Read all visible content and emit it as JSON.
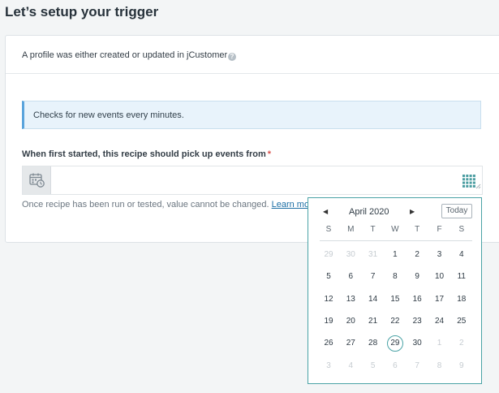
{
  "page": {
    "title": "Let’s setup your trigger"
  },
  "trigger": {
    "description": "A profile was either created or updated in jCustomer",
    "help_icon": "?"
  },
  "info": {
    "text": "Checks for new events every minutes."
  },
  "field": {
    "label": "When first started, this recipe should pick up events from",
    "required_mark": "*",
    "value": "",
    "hint": "Once recipe has been run or tested, value cannot be changed.",
    "learn_more": "Learn more"
  },
  "calendar": {
    "month_label": "April 2020",
    "prev_icon": "◀",
    "next_icon": "▶",
    "today_label": "Today",
    "weekdays": [
      "S",
      "M",
      "T",
      "W",
      "T",
      "F",
      "S"
    ],
    "weeks": [
      [
        {
          "d": "29",
          "m": true
        },
        {
          "d": "30",
          "m": true
        },
        {
          "d": "31",
          "m": true
        },
        {
          "d": "1"
        },
        {
          "d": "2"
        },
        {
          "d": "3"
        },
        {
          "d": "4"
        }
      ],
      [
        {
          "d": "5"
        },
        {
          "d": "6"
        },
        {
          "d": "7"
        },
        {
          "d": "8"
        },
        {
          "d": "9"
        },
        {
          "d": "10"
        },
        {
          "d": "11"
        }
      ],
      [
        {
          "d": "12"
        },
        {
          "d": "13"
        },
        {
          "d": "14"
        },
        {
          "d": "15"
        },
        {
          "d": "16"
        },
        {
          "d": "17"
        },
        {
          "d": "18"
        }
      ],
      [
        {
          "d": "19"
        },
        {
          "d": "20"
        },
        {
          "d": "21"
        },
        {
          "d": "22"
        },
        {
          "d": "23"
        },
        {
          "d": "24"
        },
        {
          "d": "25"
        }
      ],
      [
        {
          "d": "26"
        },
        {
          "d": "27"
        },
        {
          "d": "28"
        },
        {
          "d": "29",
          "s": true
        },
        {
          "d": "30"
        },
        {
          "d": "1",
          "m": true
        },
        {
          "d": "2",
          "m": true
        }
      ],
      [
        {
          "d": "3",
          "m": true
        },
        {
          "d": "4",
          "m": true
        },
        {
          "d": "5",
          "m": true
        },
        {
          "d": "6",
          "m": true
        },
        {
          "d": "7",
          "m": true
        },
        {
          "d": "8",
          "m": true
        },
        {
          "d": "9",
          "m": true
        }
      ]
    ],
    "selected_day": "29"
  },
  "colors": {
    "accent": "#4aa3a6",
    "info_border": "#5aa4dc",
    "link": "#1d6fa5",
    "required": "#d9534f"
  },
  "icons": {
    "date_addon": "calendar-clock-icon",
    "picker_toggle": "grid-icon"
  }
}
